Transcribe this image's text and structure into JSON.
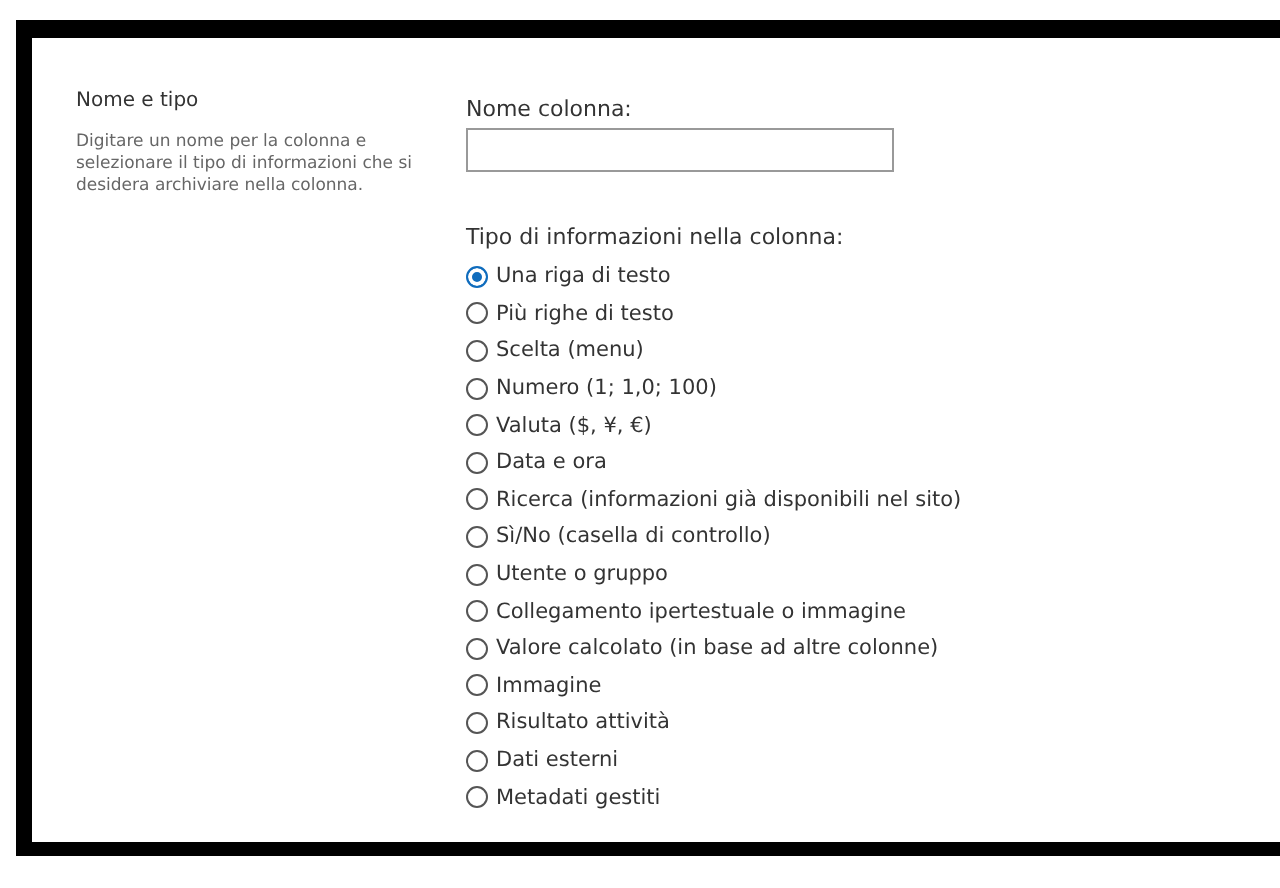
{
  "section": {
    "title": "Nome e tipo",
    "description": "Digitare un nome per la colonna e selezionare il tipo di informazioni che si desidera archiviare nella colonna."
  },
  "name_field": {
    "label": "Nome colonna:"
  },
  "type_group": {
    "label": "Tipo di informazioni nella colonna:",
    "options": [
      {
        "label": "Una riga di testo",
        "selected": true
      },
      {
        "label": "Più righe di testo",
        "selected": false
      },
      {
        "label": "Scelta (menu)",
        "selected": false
      },
      {
        "label": "Numero (1; 1,0; 100)",
        "selected": false
      },
      {
        "label": "Valuta ($, ¥, €)",
        "selected": false
      },
      {
        "label": "Data e ora",
        "selected": false
      },
      {
        "label": "Ricerca (informazioni già disponibili nel sito)",
        "selected": false
      },
      {
        "label": "Sì/No (casella di controllo)",
        "selected": false
      },
      {
        "label": "Utente o gruppo",
        "selected": false
      },
      {
        "label": "Collegamento ipertestuale o immagine",
        "selected": false
      },
      {
        "label": "Valore calcolato (in base ad altre colonne)",
        "selected": false
      },
      {
        "label": "Immagine",
        "selected": false
      },
      {
        "label": "Risultato attività",
        "selected": false
      },
      {
        "label": "Dati esterni",
        "selected": false
      },
      {
        "label": "Metadati gestiti",
        "selected": false
      }
    ]
  }
}
